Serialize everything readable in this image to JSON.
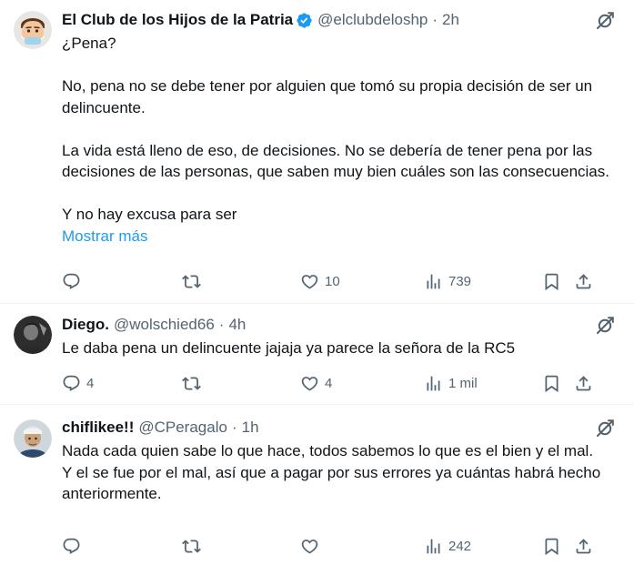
{
  "tweets": [
    {
      "name": "El Club de los Hijos de la Patria",
      "handle": "@elclubdeloshp",
      "dot": "·",
      "time": "2h",
      "verified": true,
      "lines": [
        "¿Pena?",
        "No, pena no se debe tener por alguien que tomó su propia decisión de ser un delincuente.",
        "La vida está lleno de eso, de decisiones. No se debería de tener pena por las decisiones de las personas, que saben muy bien cuáles son las consecuencias.",
        "Y no hay excusa para ser"
      ],
      "show_more": "Mostrar más",
      "replies": "",
      "retweets": "",
      "likes": "10",
      "views": "739"
    },
    {
      "name": "Diego.",
      "handle": "@wolschied66",
      "dot": "·",
      "time": "4h",
      "verified": false,
      "lines": [
        "Le daba pena un delincuente jajaja ya parece la señora de la RC5"
      ],
      "replies": "4",
      "retweets": "",
      "likes": "4",
      "views": "1 mil"
    },
    {
      "name": "chiflikee!!",
      "handle": "@CPeragalo",
      "dot": "·",
      "time": "1h",
      "verified": false,
      "lines": [
        "Nada cada quien sabe lo que hace, todos sabemos lo que es el bien y el mal.",
        "Y el se fue por el mal, así que a pagar por sus errores ya cuántas habrá hecho anteriormente."
      ],
      "replies": "",
      "retweets": "",
      "likes": "",
      "views": "242"
    }
  ],
  "colors": {
    "text": "#0f1419",
    "secondary": "#536471",
    "link": "#1d9bf0",
    "verified": "#1d9bf0",
    "divider": "#eff3f4"
  },
  "icons": {
    "reply": "reply-icon",
    "retweet": "retweet-icon",
    "like": "heart-icon",
    "views": "views-chart-icon",
    "bookmark": "bookmark-icon",
    "share": "share-icon",
    "grok": "grok-icon",
    "verified": "verified-badge-icon"
  }
}
